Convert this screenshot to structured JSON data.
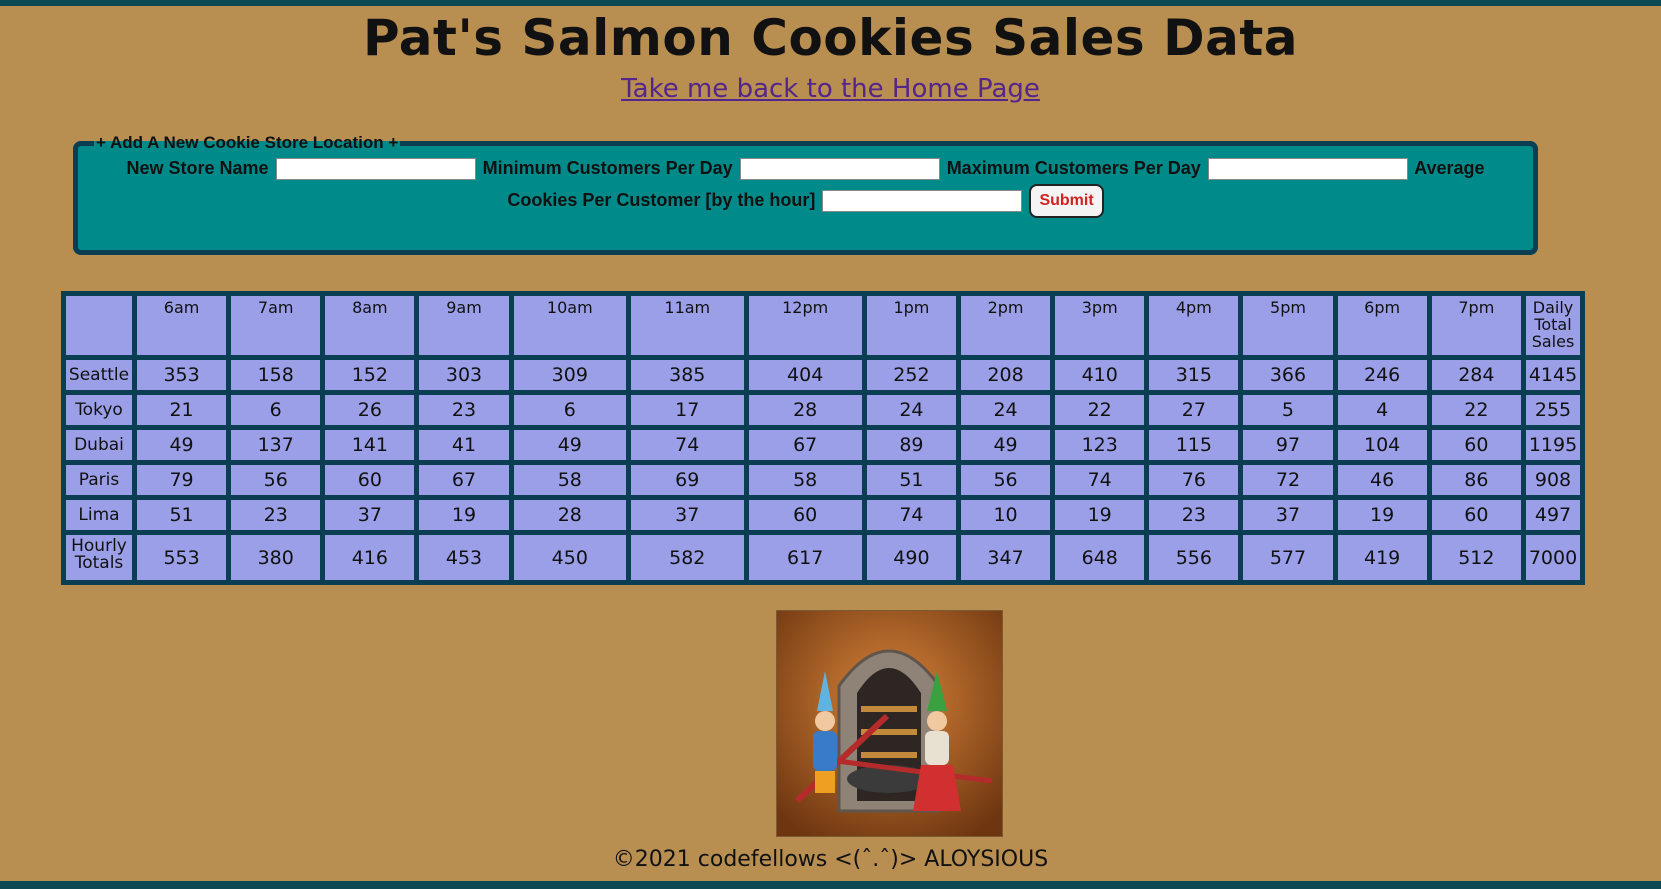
{
  "header": {
    "title": "Pat's Salmon Cookies Sales Data",
    "home_link": "Take me back to the Home Page"
  },
  "form": {
    "legend": "+ Add A New Cookie Store Location +",
    "store_name_label": "New Store Name",
    "min_label": "Minimum Customers Per Day",
    "max_label": "Maximum Customers Per Day",
    "avg_label_part1": "Average",
    "avg_label_part2": "Cookies Per Customer [by the hour]",
    "submit_label": "Submit"
  },
  "table": {
    "headers": [
      "",
      "6am",
      "7am",
      "8am",
      "9am",
      "10am",
      "11am",
      "12pm",
      "1pm",
      "2pm",
      "3pm",
      "4pm",
      "5pm",
      "6pm",
      "7pm",
      "Daily Total Sales"
    ],
    "rows": [
      [
        "Seattle",
        "353",
        "158",
        "152",
        "303",
        "309",
        "385",
        "404",
        "252",
        "208",
        "410",
        "315",
        "366",
        "246",
        "284",
        "4145"
      ],
      [
        "Tokyo",
        "21",
        "6",
        "26",
        "23",
        "6",
        "17",
        "28",
        "24",
        "24",
        "22",
        "27",
        "5",
        "4",
        "22",
        "255"
      ],
      [
        "Dubai",
        "49",
        "137",
        "141",
        "41",
        "49",
        "74",
        "67",
        "89",
        "49",
        "123",
        "115",
        "97",
        "104",
        "60",
        "1195"
      ],
      [
        "Paris",
        "79",
        "56",
        "60",
        "67",
        "58",
        "69",
        "58",
        "51",
        "56",
        "74",
        "76",
        "72",
        "46",
        "86",
        "908"
      ],
      [
        "Lima",
        "51",
        "23",
        "37",
        "19",
        "28",
        "37",
        "60",
        "74",
        "10",
        "19",
        "23",
        "37",
        "19",
        "60",
        "497"
      ]
    ],
    "totals": [
      "Hourly Totals",
      "553",
      "380",
      "416",
      "453",
      "450",
      "582",
      "617",
      "490",
      "347",
      "648",
      "556",
      "577",
      "419",
      "512",
      "7000"
    ]
  },
  "footer": {
    "text": "©2021 codefellows <(ˆ.ˆ)> ALOYSIOUS"
  }
}
